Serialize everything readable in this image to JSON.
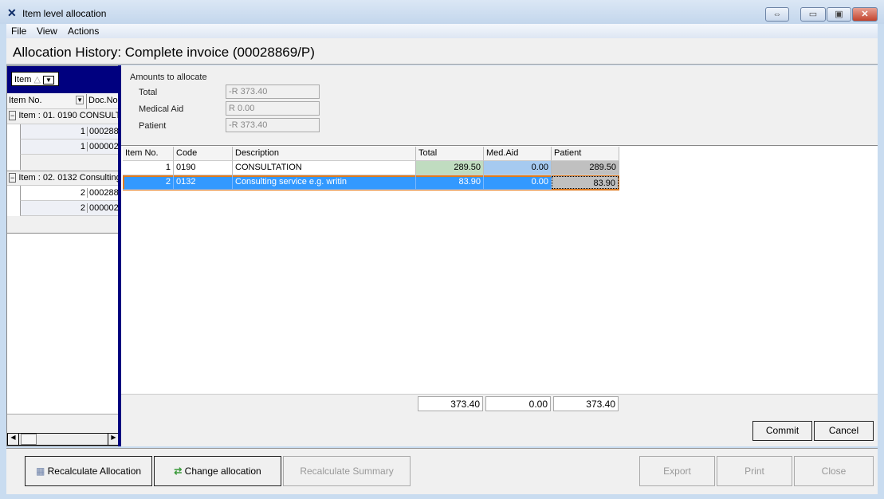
{
  "window": {
    "title": "Item level allocation",
    "icon": "tools-icon"
  },
  "menu": [
    "File",
    "View",
    "Actions"
  ],
  "page_title": "Allocation History: Complete invoice (00028869/P)",
  "left_panel": {
    "group_by": "Item",
    "columns": [
      "Item No.",
      "Doc.No"
    ],
    "groups": [
      {
        "label": "Item : 01. 0190 CONSULT",
        "rows": [
          {
            "item": "1",
            "doc": "000288"
          },
          {
            "item": "1",
            "doc": "000002"
          }
        ]
      },
      {
        "label": "Item : 02. 0132 Consulting",
        "rows": [
          {
            "item": "2",
            "doc": "000288"
          },
          {
            "item": "2",
            "doc": "000002"
          }
        ]
      }
    ]
  },
  "amounts": {
    "heading": "Amounts to allocate",
    "fields": [
      {
        "label": "Total",
        "value": "-R 373.40"
      },
      {
        "label": "Medical Aid",
        "value": "R 0.00"
      },
      {
        "label": "Patient",
        "value": "-R 373.40"
      }
    ]
  },
  "grid": {
    "columns": [
      "Item No.",
      "Code",
      "Description",
      "Total",
      "Med.Aid",
      "Patient"
    ],
    "rows": [
      {
        "item": "1",
        "code": "0190",
        "desc": "CONSULTATION",
        "total": "289.50",
        "medaid": "0.00",
        "patient": "289.50"
      },
      {
        "item": "2",
        "code": "0132",
        "desc": "Consulting service e.g. writin",
        "total": "83.90",
        "medaid": "0.00",
        "patient": "83.90",
        "selected": true
      }
    ],
    "totals": {
      "total": "373.40",
      "medaid": "0.00",
      "patient": "373.40"
    }
  },
  "buttons": {
    "commit": "Commit",
    "cancel": "Cancel",
    "recalc_alloc": "Recalculate Allocation",
    "change_alloc": "Change allocation",
    "recalc_summary": "Recalculate Summary",
    "export": "Export",
    "print": "Print",
    "close": "Close"
  },
  "colors": {
    "selection": "#3399ff",
    "total_cell": "#c0dcc0",
    "medaid_cell": "#a6caf0",
    "patient_cell": "#c0c0c0",
    "navy": "#00007f"
  }
}
